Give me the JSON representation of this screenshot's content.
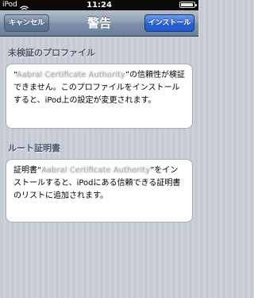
{
  "status_bar": {
    "carrier": "iPod",
    "time": "11:24"
  },
  "nav": {
    "title": "警告",
    "cancel_label": "キャンセル",
    "install_label": "インストール"
  },
  "unverified": {
    "header": "未検証のプロファイル",
    "body_pre": "“",
    "blurred_name": "Aabral Certificate Authority",
    "body_post": "”の信頼性が検証できません。このプロファイルをインストールすると、iPod上の設定が変更されます。"
  },
  "root_cert": {
    "header": "ルート証明書",
    "body_pre": "証明書“",
    "blurred_name": "Aabral Certificate Authority",
    "body_post": "”をインストールすると、iPodにある信頼できる証明書のリストに追加されます。"
  },
  "colors": {
    "nav_blue": "#6d819b",
    "install_blue": "#2760d2",
    "header_text": "#4c566c",
    "background": "#c7ccd6"
  }
}
